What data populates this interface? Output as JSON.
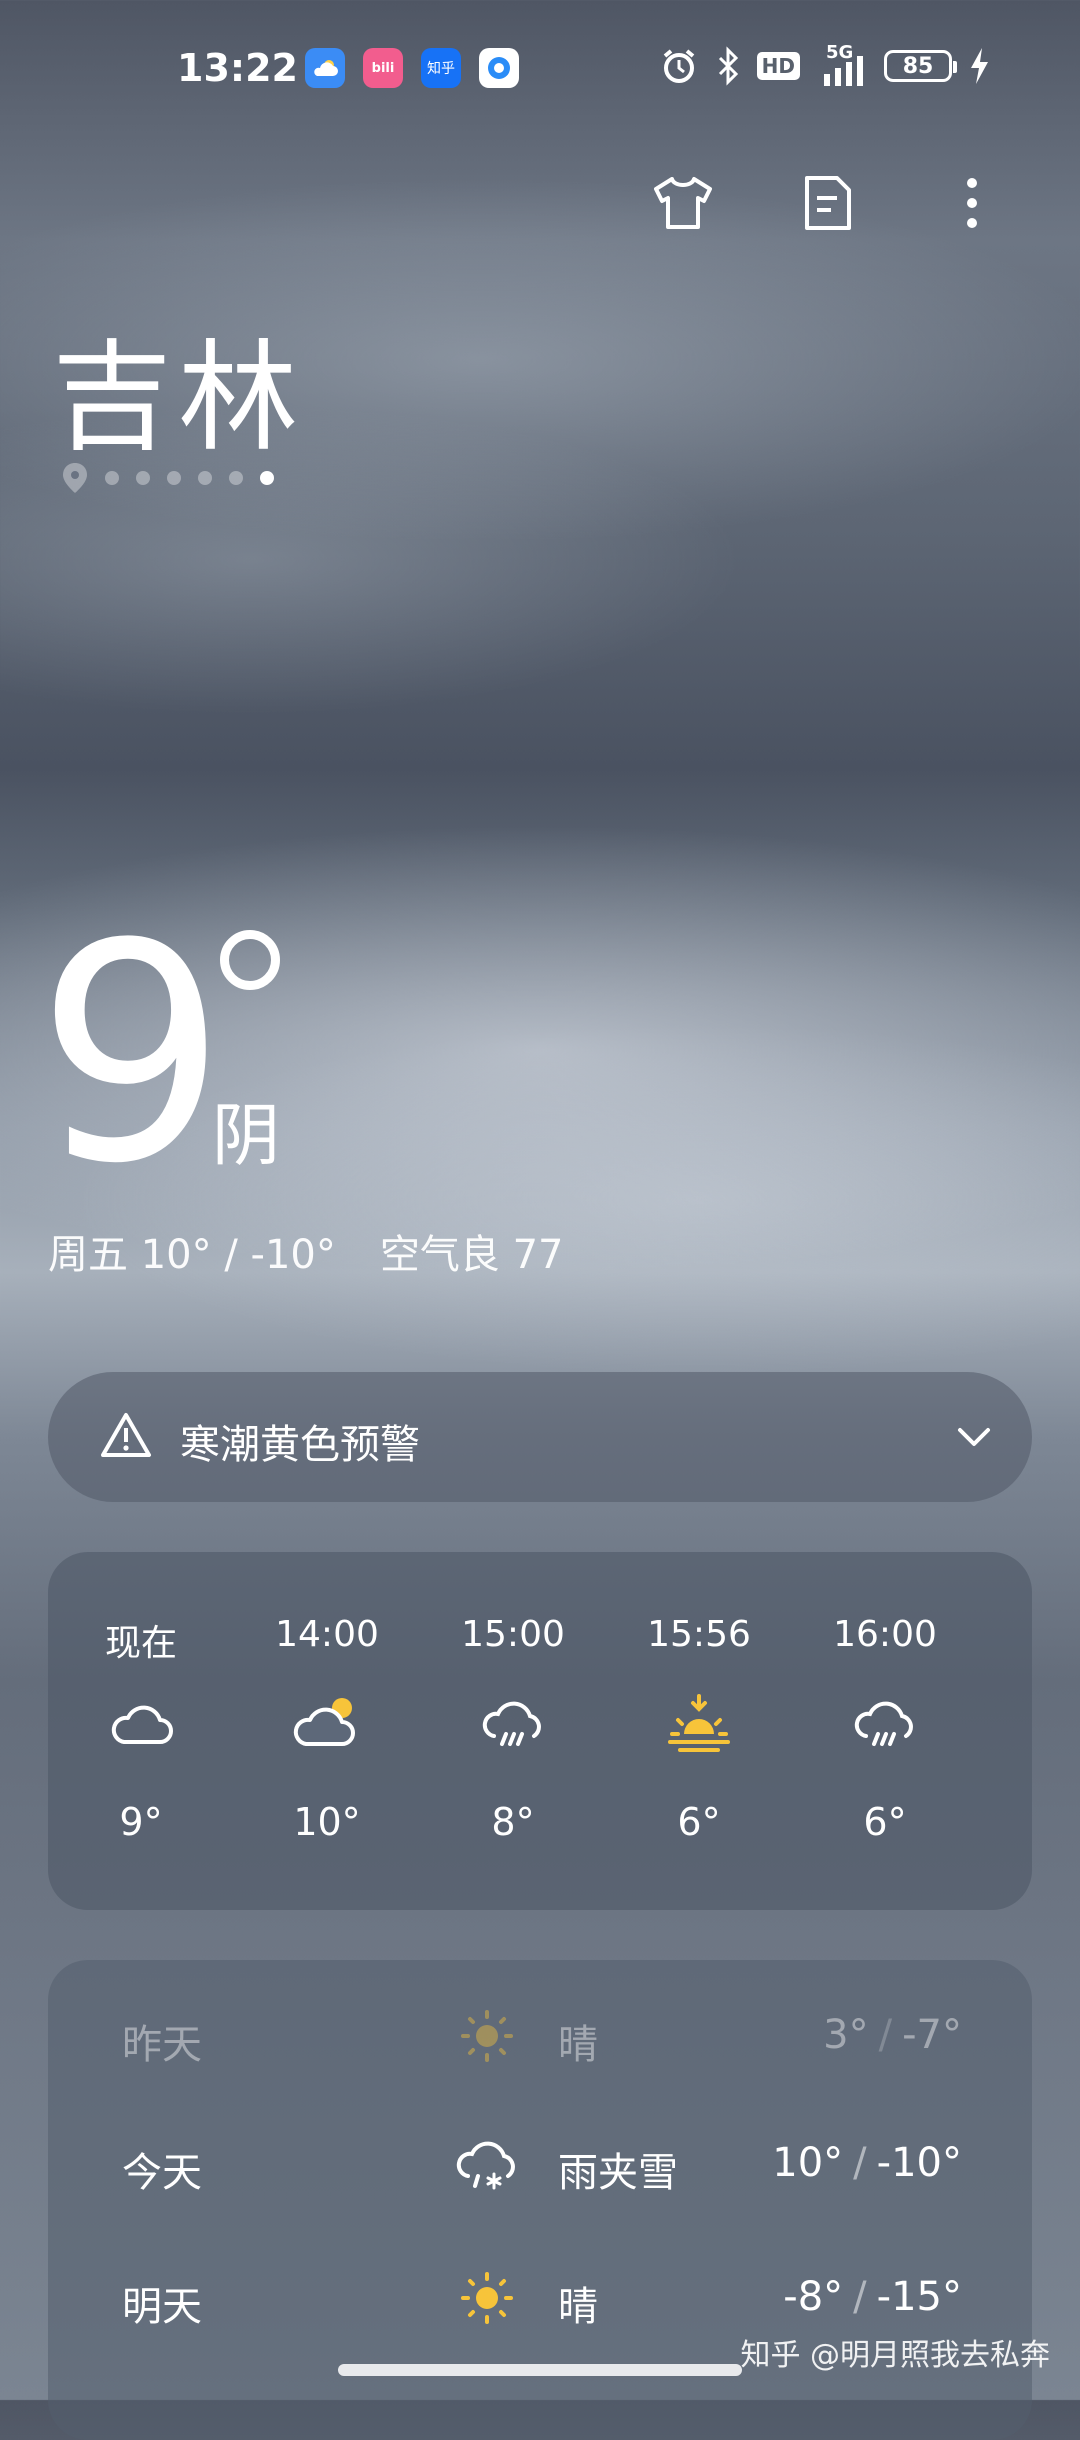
{
  "status_bar": {
    "time": "13:22",
    "apps": [
      {
        "icon": "weather-app-icon",
        "label": "",
        "color": "#3b8cf5"
      },
      {
        "icon": "bilibili-app-icon",
        "label": "bili",
        "color": "#f25d8e"
      },
      {
        "icon": "zhihu-app-icon",
        "label": "知乎",
        "color": "#1772f6"
      },
      {
        "icon": "browser-app-icon",
        "label": "",
        "color": "#2a8cf7"
      }
    ],
    "network": "5G",
    "hd": "HD",
    "battery": "85"
  },
  "actions": {
    "theme_icon": "shirt-icon",
    "notes_icon": "document-icon",
    "more_icon": "more-vertical-icon"
  },
  "location": {
    "city": "吉林",
    "page_count": 7,
    "active_page": 6
  },
  "current": {
    "temp": "9",
    "condition": "阴",
    "weekday_range": "周五 10° / -10°",
    "air_quality": "空气良 77"
  },
  "alert": {
    "text": "寒潮黄色预警"
  },
  "hourly": [
    {
      "time": "现在",
      "icon": "cloudy",
      "temp": "9°"
    },
    {
      "time": "14:00",
      "icon": "partly-cloudy",
      "temp": "10°"
    },
    {
      "time": "15:00",
      "icon": "rain",
      "temp": "8°"
    },
    {
      "time": "15:56",
      "icon": "sunset",
      "temp": "6°"
    },
    {
      "time": "16:00",
      "icon": "rain",
      "temp": "6°"
    }
  ],
  "daily": [
    {
      "day": "昨天",
      "icon": "sunny",
      "condition": "晴",
      "high": "3°",
      "low": "-7°"
    },
    {
      "day": "今天",
      "icon": "sleet",
      "condition": "雨夹雪",
      "high": "10°",
      "low": "-10°"
    },
    {
      "day": "明天",
      "icon": "sunny",
      "condition": "晴",
      "high": "-8°",
      "low": "-15°"
    }
  ],
  "colors": {
    "sun": "#f7c43a",
    "white": "#ffffff"
  },
  "watermark": "知乎 @明月照我去私奔"
}
